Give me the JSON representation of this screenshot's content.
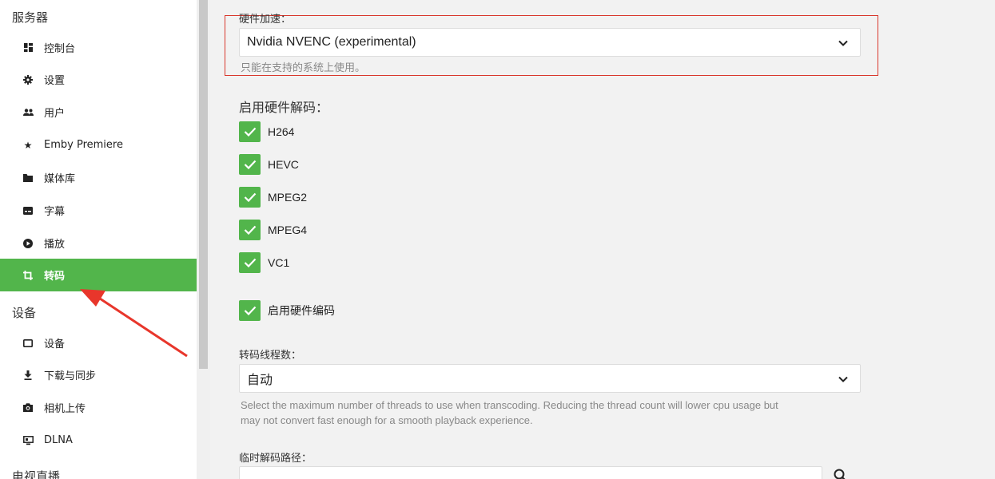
{
  "sidebar": {
    "section_server": "服务器",
    "section_devices": "设备",
    "section_livetv": "电视直播",
    "items": [
      {
        "label": "控制台",
        "icon": "dashboard-icon"
      },
      {
        "label": "设置",
        "icon": "gear-icon"
      },
      {
        "label": "用户",
        "icon": "people-icon"
      },
      {
        "label": "Emby Premiere",
        "icon": "star-icon"
      },
      {
        "label": "媒体库",
        "icon": "folder-icon"
      },
      {
        "label": "字幕",
        "icon": "subtitles-icon"
      },
      {
        "label": "播放",
        "icon": "play-circle-icon"
      },
      {
        "label": "转码",
        "icon": "transcode-icon",
        "active": true
      }
    ],
    "device_items": [
      {
        "label": "设备",
        "icon": "tablet-icon"
      },
      {
        "label": "下载与同步",
        "icon": "download-icon"
      },
      {
        "label": "相机上传",
        "icon": "camera-icon"
      },
      {
        "label": "DLNA",
        "icon": "dlna-icon"
      }
    ]
  },
  "main": {
    "hw_accel": {
      "label": "硬件加速：",
      "value": "Nvidia NVENC (experimental)",
      "help": "只能在支持的系统上使用。"
    },
    "hw_decode": {
      "title": "启用硬件解码：",
      "codecs": [
        {
          "label": "H264",
          "checked": true
        },
        {
          "label": "HEVC",
          "checked": true
        },
        {
          "label": "MPEG2",
          "checked": true
        },
        {
          "label": "MPEG4",
          "checked": true
        },
        {
          "label": "VC1",
          "checked": true
        }
      ]
    },
    "hw_encode": {
      "label": "启用硬件编码",
      "checked": true
    },
    "threads": {
      "label": "转码线程数：",
      "value": "自动",
      "help_line1": "Select the maximum number of threads to use when transcoding. Reducing the thread count will lower cpu usage but",
      "help_line2": "may not convert fast enough for a smooth playback experience."
    },
    "temp_path": {
      "label": "临时解码路径：",
      "value": ""
    }
  },
  "colors": {
    "accent": "#52b54b",
    "highlight_border": "#d9372c",
    "arrow": "#e8362b"
  }
}
